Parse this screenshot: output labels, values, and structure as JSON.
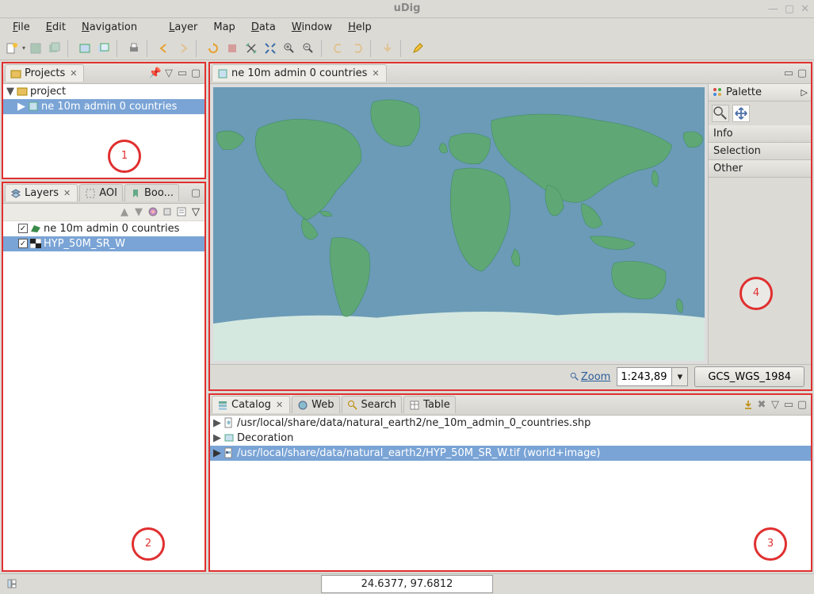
{
  "window": {
    "title": "uDig"
  },
  "menu": {
    "file": "File",
    "edit": "Edit",
    "nav": "Navigation",
    "layer": "Layer",
    "map": "Map",
    "data": "Data",
    "window": "Window",
    "help": "Help"
  },
  "projects": {
    "tab": "Projects",
    "root": "project",
    "child": "ne 10m admin 0 countries"
  },
  "layers": {
    "tab": "Layers",
    "aoi": "AOI",
    "book": "Boo...",
    "l1": "ne 10m admin 0 countries",
    "l2": "HYP_50M_SR_W"
  },
  "mapview": {
    "tab": "ne 10m admin 0 countries",
    "zoom": "Zoom",
    "scale": "1:243,89",
    "crs": "GCS_WGS_1984"
  },
  "palette": {
    "title": "Palette",
    "info": "Info",
    "sel": "Selection",
    "other": "Other"
  },
  "catalog": {
    "t1": "Catalog",
    "t2": "Web",
    "t3": "Search",
    "t4": "Table",
    "r1": "/usr/local/share/data/natural_earth2/ne_10m_admin_0_countries.shp",
    "r2": "Decoration",
    "r3": "/usr/local/share/data/natural_earth2/HYP_50M_SR_W.tif (world+image)"
  },
  "status": {
    "coords": "24.6377, 97.6812"
  },
  "annotations": {
    "n1": "1",
    "n2": "2",
    "n3": "3",
    "n4": "4"
  }
}
